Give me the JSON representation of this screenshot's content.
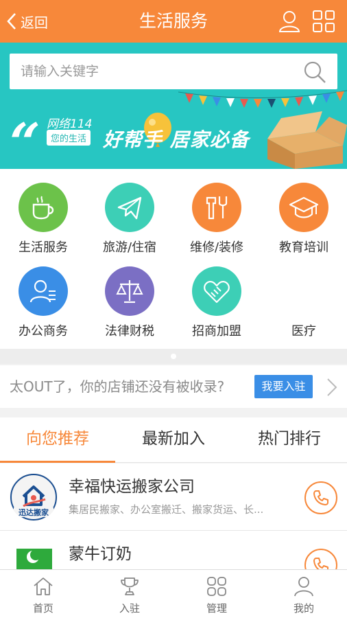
{
  "header": {
    "back_label": "返回",
    "title": "生活服务",
    "bg_color": "#f7883a",
    "icons": [
      "user-icon",
      "grid-icon"
    ]
  },
  "search": {
    "placeholder": "请输入关键字"
  },
  "banner": {
    "brand": "网络114",
    "tag": "您的生活",
    "slogan": "好帮手 居家必备",
    "bg_color": "#27c6c2"
  },
  "categories": [
    {
      "label": "生活服务",
      "icon": "cup-icon",
      "color": "#6cc24a"
    },
    {
      "label": "旅游/住宿",
      "icon": "airplane-icon",
      "color": "#3dcfb6"
    },
    {
      "label": "维修/装修",
      "icon": "tools-icon",
      "color": "#f7883a"
    },
    {
      "label": "教育培训",
      "icon": "graduation-cap-icon",
      "color": "#f7883a"
    },
    {
      "label": "办公商务",
      "icon": "person-card-icon",
      "color": "#3a8ee6"
    },
    {
      "label": "法律财税",
      "icon": "scales-icon",
      "color": "#7b6fc4"
    },
    {
      "label": "招商加盟",
      "icon": "handshake-icon",
      "color": "#3dcfb6"
    },
    {
      "label": "医疗",
      "icon": "",
      "color": ""
    }
  ],
  "promo": {
    "text": "太OUT了，你的店铺还没有被收录?",
    "button": "我要入驻"
  },
  "tabs": [
    {
      "label": "向您推荐",
      "active": true
    },
    {
      "label": "最新加入",
      "active": false
    },
    {
      "label": "热门排行",
      "active": false
    }
  ],
  "listings": [
    {
      "name": "幸福快运搬家公司",
      "desc": "集居民搬家、办公室搬迁、搬家货运、长...",
      "logo_text": "迅达搬家"
    },
    {
      "name": "蒙牛订奶",
      "desc": "",
      "logo_text": ""
    }
  ],
  "bottom_nav": [
    {
      "label": "首页",
      "icon": "home-icon"
    },
    {
      "label": "入驻",
      "icon": "trophy-icon"
    },
    {
      "label": "管理",
      "icon": "four-grid-icon"
    },
    {
      "label": "我的",
      "icon": "user-icon"
    }
  ]
}
